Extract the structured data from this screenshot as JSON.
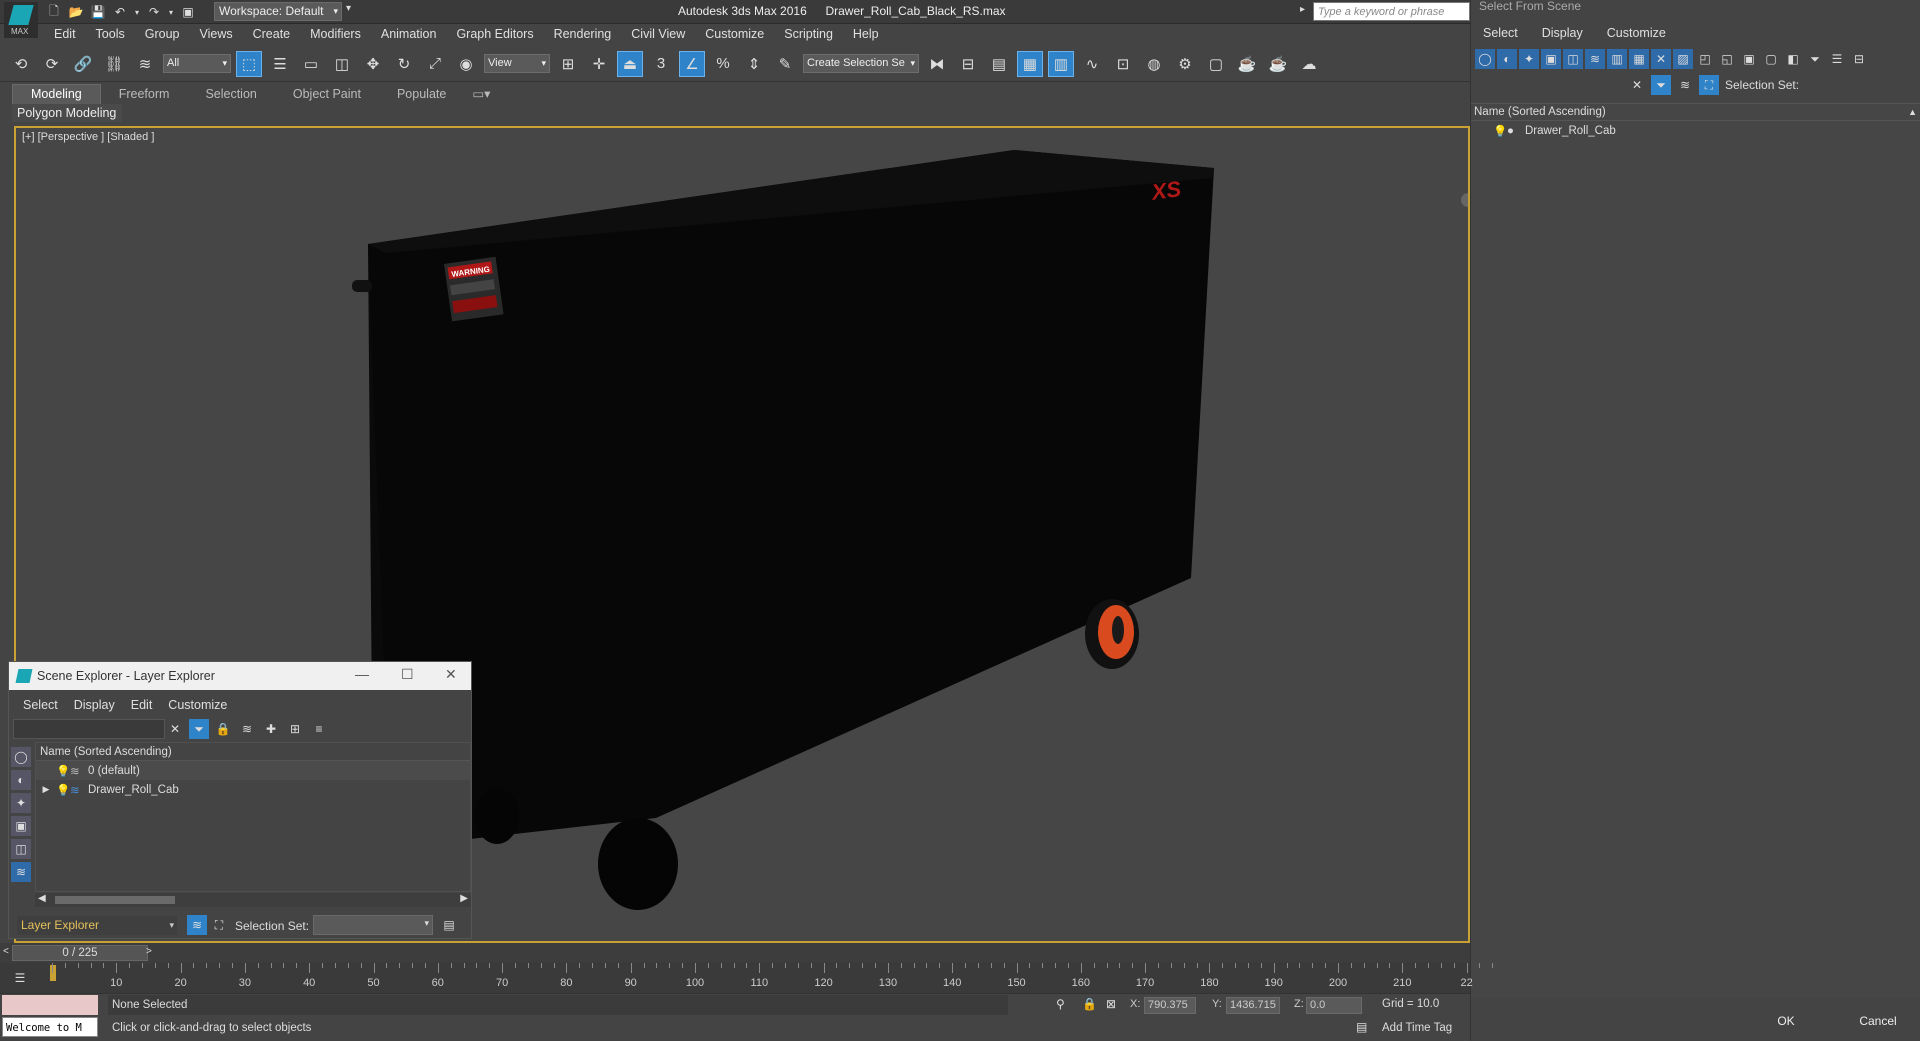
{
  "app": {
    "logo_text": "MAX",
    "title": "Autodesk 3ds Max 2016",
    "file_name": "Drawer_Roll_Cab_Black_RS.max",
    "workspace": "Workspace: Default",
    "search_placeholder": "Type a keyword or phrase"
  },
  "menu": [
    "Edit",
    "Tools",
    "Group",
    "Views",
    "Create",
    "Modifiers",
    "Animation",
    "Graph Editors",
    "Rendering",
    "Civil View",
    "Customize",
    "Scripting",
    "Help"
  ],
  "toolbar": {
    "selection_filter": "All",
    "ref_coord": "View",
    "named_selection": "Create Selection Se"
  },
  "ribbon": {
    "tabs": [
      "Modeling",
      "Freeform",
      "Selection",
      "Object Paint",
      "Populate"
    ],
    "active_tab": "Modeling",
    "panel_label": "Polygon Modeling"
  },
  "viewport": {
    "label": "[+] [Perspective ] [Shaded ]",
    "object_decal_warning": "WARNING",
    "object_brand": "XS",
    "accent_color": "#c9a233",
    "wheel_color": "#d94a1e"
  },
  "scene_explorer": {
    "title": "Scene Explorer - Layer Explorer",
    "menu": [
      "Select",
      "Display",
      "Edit",
      "Customize"
    ],
    "column_header": "Name (Sorted Ascending)",
    "rows": [
      "0 (default)",
      "Drawer_Roll_Cab"
    ],
    "explorer_mode": "Layer Explorer",
    "selection_set_label": "Selection Set:"
  },
  "select_from_scene": {
    "title": "Select From Scene",
    "menu": [
      "Select",
      "Display",
      "Customize"
    ],
    "selection_set_label": "Selection Set:",
    "column_header": "Name (Sorted Ascending)",
    "rows": [
      "Drawer_Roll_Cab"
    ],
    "ok_label": "OK",
    "cancel_label": "Cancel"
  },
  "timeline": {
    "frame_display": "0 / 225",
    "ticks": [
      "10",
      "20",
      "30",
      "40",
      "50",
      "60",
      "70",
      "80",
      "90",
      "100",
      "110",
      "120",
      "130",
      "140",
      "150",
      "160",
      "170",
      "180",
      "190",
      "200",
      "210",
      "22"
    ]
  },
  "status": {
    "maxscript_text": "Welcome to M",
    "selection": "None Selected",
    "prompt": "Click or click-and-drag to select objects",
    "x_label": "X:",
    "x": "790.375",
    "y_label": "Y:",
    "y": "1436.715",
    "z_label": "Z:",
    "z": "0.0",
    "grid": "Grid = 10.0",
    "add_time_tag": "Add Time Tag"
  }
}
